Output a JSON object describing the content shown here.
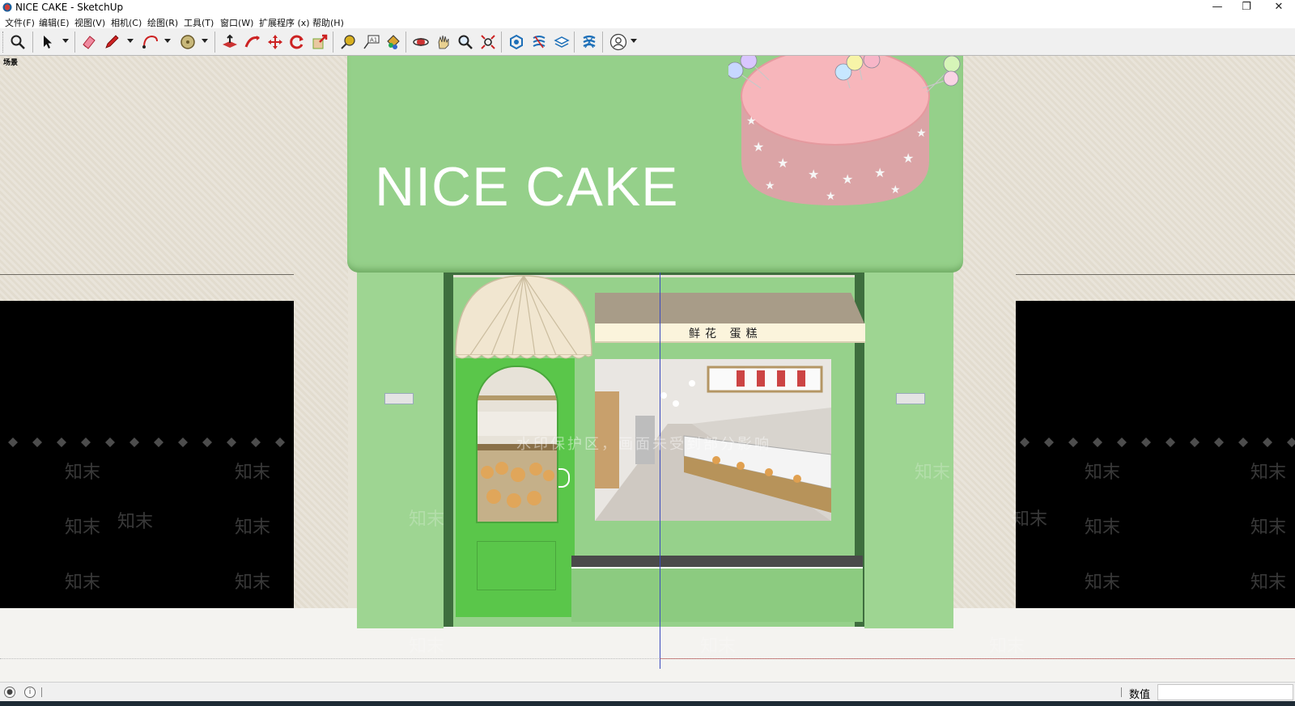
{
  "window": {
    "title": "NICE CAKE - SketchUp",
    "icon": "sketchup-app-icon",
    "controls": {
      "minimize": "—",
      "maximize": "❐",
      "close": "✕"
    }
  },
  "menu": [
    {
      "label": "文件(F)"
    },
    {
      "label": "编辑(E)"
    },
    {
      "label": "视图(V)"
    },
    {
      "label": "相机(C)"
    },
    {
      "label": "绘图(R)"
    },
    {
      "label": "工具(T)"
    },
    {
      "label": "窗口(W)"
    },
    {
      "label": "扩展程序 (x)"
    },
    {
      "label": "帮助(H)"
    }
  ],
  "toolbar": {
    "tools": [
      "zoom-icon",
      "select-arrow-icon",
      "eraser-icon",
      "pencil-line-icon",
      "arc-icon",
      "shape-circle-icon",
      "push-pull-icon",
      "follow-me-icon",
      "move-icon",
      "rotate-icon",
      "scale-icon",
      "tape-measure-icon",
      "text-label-icon",
      "paint-bucket-icon",
      "orbit-icon",
      "pan-icon",
      "zoom-tool-icon",
      "zoom-extents-icon",
      "warehouse-icon",
      "extension-warehouse-icon",
      "layout-icon",
      "styles-icon",
      "account-icon"
    ]
  },
  "viewport": {
    "scene_tab": "场景",
    "model": {
      "sign_text": "NICE CAKE",
      "awning_text": "鲜花  蛋糕"
    },
    "watermark": {
      "center_text": "水印保护区，画面未受到部分影响",
      "brand_text": "知末"
    }
  },
  "statusbar": {
    "measurements_label": "数值",
    "measurements_value": ""
  },
  "colors": {
    "facade_green": "#95d08a",
    "door_green": "#5ac64a",
    "cake_pink": "#f7b6bb",
    "wall_beige": "#e4ded2"
  }
}
